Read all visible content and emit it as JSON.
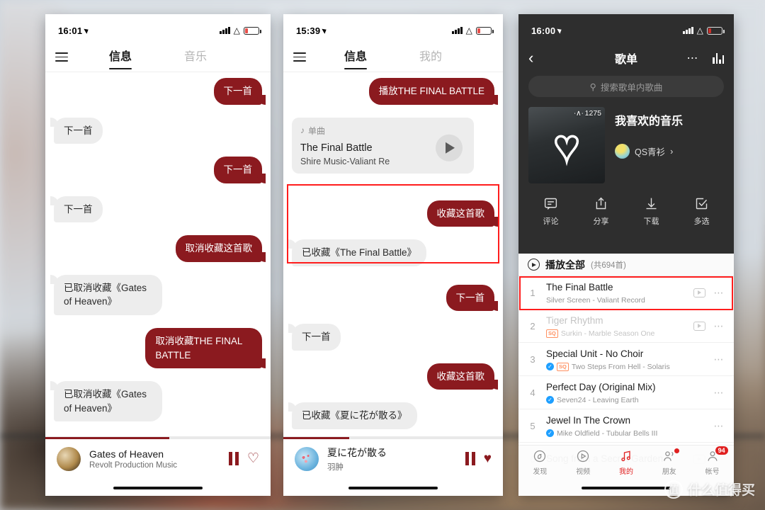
{
  "background": {
    "description": "blurred desk photo backdrop",
    "accent": "#8b1a1f"
  },
  "phone1": {
    "status": {
      "time": "16:01",
      "battery_low": true
    },
    "header": {
      "menu_icon": "hamburger-icon",
      "tabs": [
        {
          "label": "信息",
          "active": true
        },
        {
          "label": "音乐",
          "active": false
        }
      ]
    },
    "messages": [
      {
        "side": "out",
        "text": "下一首"
      },
      {
        "side": "in",
        "text": "下一首"
      },
      {
        "side": "out",
        "text": "下一首"
      },
      {
        "side": "in",
        "text": "下一首"
      },
      {
        "side": "out",
        "text": "取消收藏这首歌"
      },
      {
        "side": "in",
        "text": "已取消收藏《Gates of Heaven》"
      },
      {
        "side": "out",
        "text": "取消收藏THE FINAL BATTLE"
      },
      {
        "side": "in",
        "text": "已取消收藏《Gates of Heaven》"
      }
    ],
    "player": {
      "title": "Gates of Heaven",
      "artist": "Revolt Production Music",
      "pause_icon": "pause-icon",
      "favorite_icon": "heart-outline-icon",
      "favorited": false,
      "progress_percent": 55
    }
  },
  "phone2": {
    "status": {
      "time": "15:39",
      "battery_low": true
    },
    "header": {
      "menu_icon": "hamburger-icon",
      "tabs": [
        {
          "label": "信息",
          "active": true
        },
        {
          "label": "我的",
          "active": false
        }
      ]
    },
    "messages_top": [
      {
        "side": "out",
        "text": "播放THE FINAL BATTLE"
      }
    ],
    "song_card": {
      "kind_icon": "music-note-icon",
      "kind": "单曲",
      "title": "The Final Battle",
      "subtitle": "Shire Music-Valiant Re",
      "play_icon": "play-icon"
    },
    "highlighted_messages": [
      {
        "side": "out",
        "text": "收藏这首歌"
      },
      {
        "side": "in",
        "text": "已收藏《The Final Battle》"
      }
    ],
    "messages_bottom": [
      {
        "side": "out",
        "text": "下一首"
      },
      {
        "side": "in",
        "text": "下一首"
      },
      {
        "side": "out",
        "text": "收藏这首歌"
      },
      {
        "side": "in",
        "text": "已收藏《夏に花が散る》"
      }
    ],
    "player": {
      "title": "夏に花が散る",
      "artist": "羽肿",
      "pause_icon": "pause-icon",
      "favorite_icon": "heart-filled-icon",
      "favorited": true,
      "progress_percent": 30
    }
  },
  "phone3": {
    "status": {
      "time": "16:00",
      "battery_low": true
    },
    "header": {
      "back_icon": "chevron-left-icon",
      "title": "歌单",
      "more_icon": "more-dots-icon",
      "equalizer_icon": "equalizer-icon"
    },
    "search": {
      "icon": "search-icon",
      "placeholder": "搜索歌单内歌曲"
    },
    "playlist": {
      "cover_icon": "heart-outline-icon",
      "play_count_icon": "headphones-icon",
      "play_count": "1275",
      "name": "我喜欢的音乐",
      "owner": "QS青衫",
      "owner_chevron": "chevron-right-icon"
    },
    "actions": [
      {
        "label": "评论",
        "icon": "comment-icon"
      },
      {
        "label": "分享",
        "icon": "share-icon"
      },
      {
        "label": "下载",
        "icon": "download-icon"
      },
      {
        "label": "多选",
        "icon": "multi-select-icon"
      }
    ],
    "play_all": {
      "icon": "play-circle-icon",
      "label": "播放全部",
      "count": "(共694首)"
    },
    "songs": [
      {
        "index": "1",
        "title": "The Final Battle",
        "sub": "Silver Screen - Valiant Record",
        "verified": false,
        "sq": false,
        "mv": true,
        "dim": false,
        "highlighted": true
      },
      {
        "index": "2",
        "title": "Tiger Rhythm",
        "sub": "Surkin - Marble Season One",
        "verified": false,
        "sq": true,
        "mv": true,
        "dim": true,
        "highlighted": false
      },
      {
        "index": "3",
        "title": "Special Unit - No Choir",
        "sub": "Two Steps From Hell - Solaris",
        "verified": true,
        "sq": true,
        "mv": false,
        "dim": false,
        "highlighted": false
      },
      {
        "index": "4",
        "title": "Perfect Day (Original Mix)",
        "sub": "Seven24 - Leaving Earth",
        "verified": true,
        "sq": false,
        "mv": false,
        "dim": false,
        "highlighted": false
      },
      {
        "index": "5",
        "title": "Jewel In The Crown",
        "sub": "Mike Oldfield - Tubular Bells III",
        "verified": true,
        "sq": false,
        "mv": false,
        "dim": false,
        "highlighted": false
      },
      {
        "index": "6",
        "title": "Song from a Secret Garden",
        "sub": "",
        "verified": false,
        "sq": false,
        "mv": true,
        "dim": false,
        "highlighted": false
      }
    ],
    "tabbar": [
      {
        "label": "发现",
        "icon": "discover-icon",
        "active": false,
        "badge": "",
        "dot": false
      },
      {
        "label": "视频",
        "icon": "video-icon",
        "active": false,
        "badge": "",
        "dot": false
      },
      {
        "label": "我的",
        "icon": "my-music-icon",
        "active": true,
        "badge": "",
        "dot": false
      },
      {
        "label": "朋友",
        "icon": "friends-icon",
        "active": false,
        "badge": "",
        "dot": true
      },
      {
        "label": "帐号",
        "icon": "account-icon",
        "active": false,
        "badge": "94",
        "dot": false
      }
    ]
  },
  "watermark": {
    "logo": "值",
    "text": "什么值得买"
  }
}
